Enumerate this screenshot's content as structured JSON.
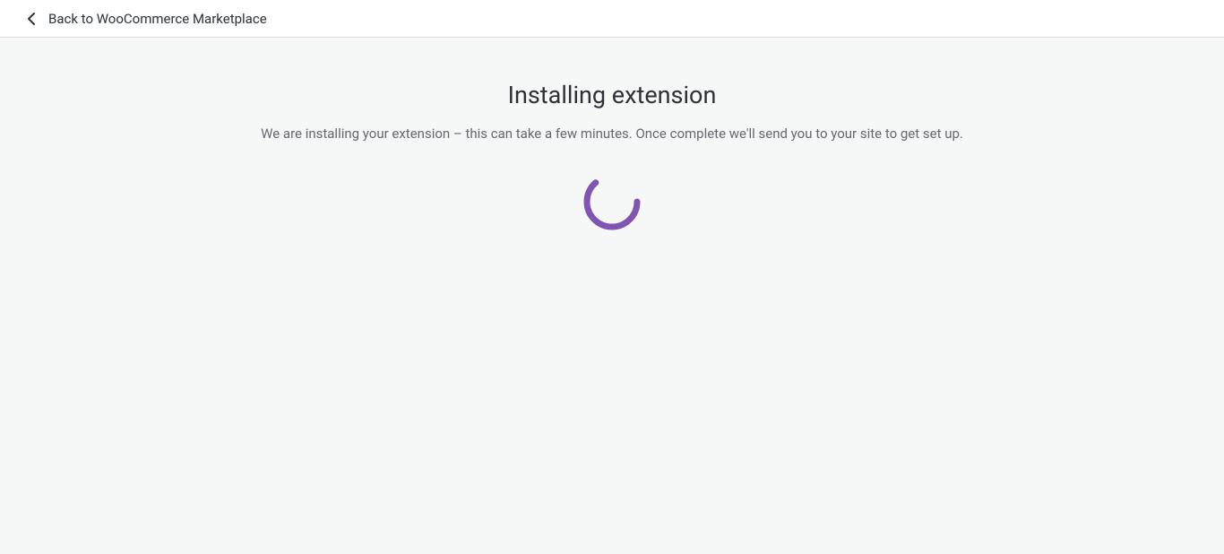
{
  "header": {
    "back_link_label": "Back to WooCommerce Marketplace"
  },
  "main": {
    "title": "Installing extension",
    "description": "We are installing your extension – this can take a few minutes. Once complete we'll send you to your site to get set up."
  },
  "colors": {
    "spinner": "#7f54b3"
  }
}
